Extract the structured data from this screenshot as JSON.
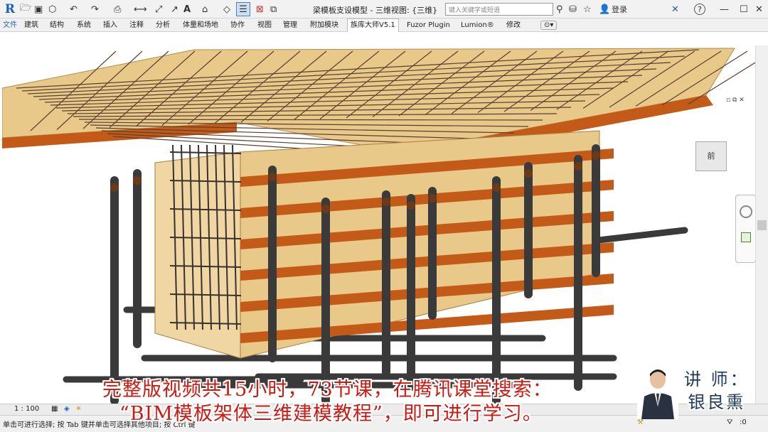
{
  "titlebar": {
    "logo": "R",
    "title": "梁模板支设模型 - 三维视图: {三维}",
    "search_placeholder": "键入关键字或短语",
    "login": "登录",
    "help": "?",
    "icons": [
      "open-icon",
      "save-icon",
      "sync-icon",
      "undo-icon",
      "redo-icon",
      "print-icon",
      "measure-icon",
      "dimension-icon",
      "text-icon",
      "3d-view-icon",
      "section-icon",
      "thin-lines-icon",
      "close-hidden-icon",
      "switch-windows-icon",
      "binoculars-icon",
      "star-icon",
      "user-icon",
      "exchange-icon",
      "help-icon",
      "minimize-icon",
      "maximize-icon",
      "close-icon"
    ]
  },
  "ribbon": {
    "tabs": [
      "文件",
      "建筑",
      "结构",
      "系统",
      "插入",
      "注释",
      "分析",
      "体量和场地",
      "协作",
      "视图",
      "管理",
      "附加模块",
      "族库大师V5.1",
      "Fuzor Plugin",
      "Lumion®",
      "修改"
    ],
    "active_tab": "族库大师V5.1"
  },
  "viewcube": {
    "face": "前"
  },
  "viewbar": {
    "scale": "1 : 100"
  },
  "status": {
    "text": "单击可进行选择; 按 Tab 键并单击可选择其他项目; 按 Ctrl 键",
    "filter_count": ":0"
  },
  "overlay": {
    "caption_line1": "完整版视频共15小时，73节课，在腾讯课堂搜索：",
    "caption_line2": "“BIM模板架体三维建模教程”，即可进行学习。",
    "teacher_label": "讲 师：",
    "teacher_name": "银良熏"
  },
  "colors": {
    "brand": "#1a5fb4",
    "caption": "#cc1a12",
    "plywood": "#e8c98a",
    "timber": "#c45a18",
    "steel": "#3a3a3a"
  }
}
